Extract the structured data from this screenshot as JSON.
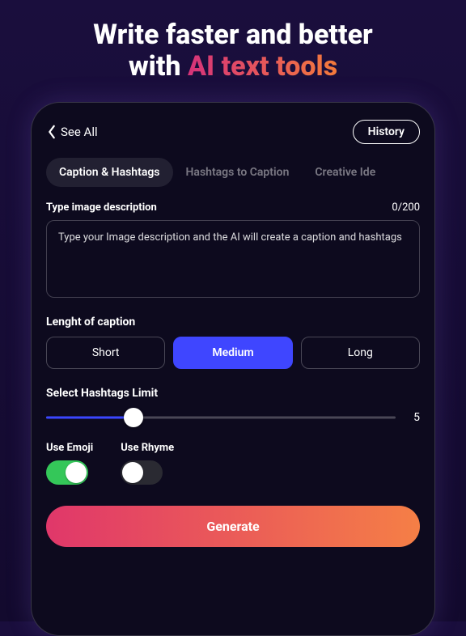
{
  "hero": {
    "line1": "Write faster and better",
    "line2_part1": "with ",
    "line2_part2": "AI text tools"
  },
  "topbar": {
    "back_label": "See All",
    "history_label": "History"
  },
  "tabs": [
    {
      "label": "Caption & Hashtags",
      "active": true
    },
    {
      "label": "Hashtags to Caption",
      "active": false
    },
    {
      "label": "Creative Ide",
      "active": false
    }
  ],
  "description": {
    "label": "Type image description",
    "counter": "0/200",
    "placeholder": "Type your Image description and the AI will create a caption and hashtags"
  },
  "length": {
    "label": "Lenght of caption",
    "options": [
      "Short",
      "Medium",
      "Long"
    ],
    "selected": "Medium"
  },
  "hashtags": {
    "label": "Select Hashtags Limit",
    "value": 5,
    "min": 0,
    "max": 20,
    "percent": 25
  },
  "toggles": {
    "emoji": {
      "label": "Use Emoji",
      "on": true
    },
    "rhyme": {
      "label": "Use Rhyme",
      "on": false
    }
  },
  "generate": {
    "label": "Generate"
  }
}
